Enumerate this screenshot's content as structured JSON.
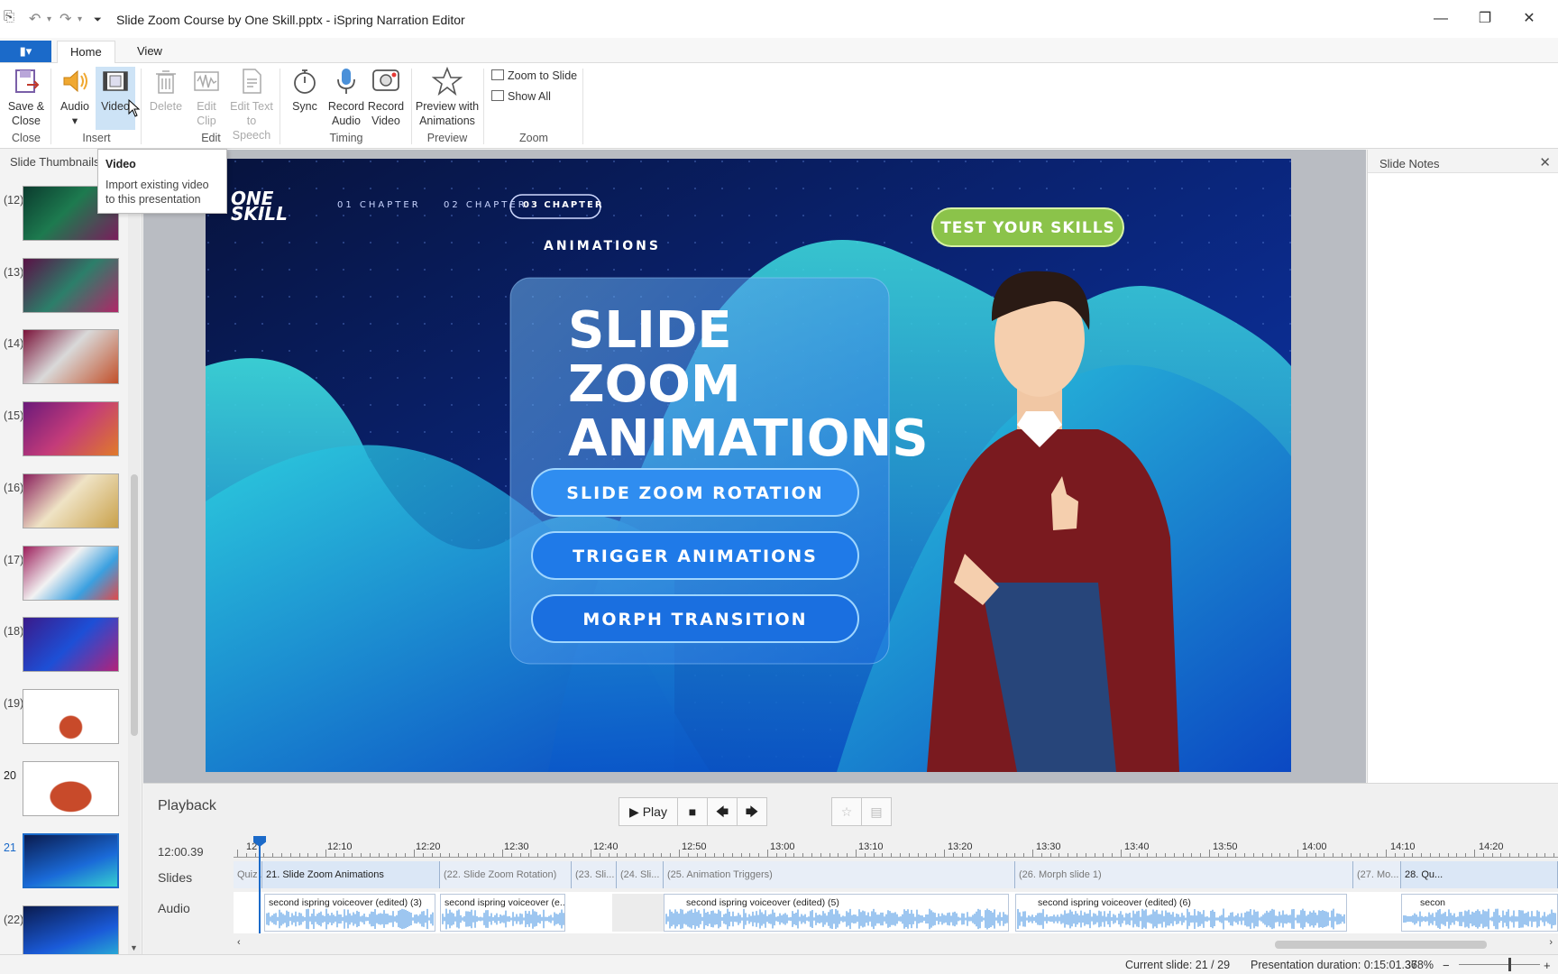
{
  "window": {
    "title": "Slide Zoom Course by One Skill.pptx - iSpring Narration Editor",
    "minimize": "—",
    "restore": "❐",
    "close": "✕"
  },
  "tabs": [
    {
      "label": "Home",
      "active": true
    },
    {
      "label": "View",
      "active": false
    }
  ],
  "ribbon": {
    "groups": {
      "close": "Close",
      "insert": "Insert",
      "edit": "Edit",
      "timing": "Timing",
      "preview": "Preview",
      "zoom": "Zoom"
    },
    "save_close": [
      "Save &",
      "Close"
    ],
    "audio": "Audio",
    "video": "Video",
    "delete": "Delete",
    "edit_clip": [
      "Edit",
      "Clip"
    ],
    "edit_text": [
      "Edit Text",
      "to Speech"
    ],
    "sync": "Sync",
    "record_audio": [
      "Record",
      "Audio"
    ],
    "record_video": [
      "Record",
      "Video"
    ],
    "preview_anim": [
      "Preview with",
      "Animations"
    ],
    "zoom_to_slide": "Zoom to Slide",
    "show_all": "Show All"
  },
  "tooltip": {
    "title": "Video",
    "description": "Import existing video to this presentation"
  },
  "thumbnails": {
    "title": "Slide Thumbnails",
    "items": [
      {
        "num": "(12)"
      },
      {
        "num": "(13)"
      },
      {
        "num": "(14)"
      },
      {
        "num": "(15)"
      },
      {
        "num": "(16)"
      },
      {
        "num": "(17)"
      },
      {
        "num": "(18)"
      },
      {
        "num": "(19)"
      },
      {
        "num": "20"
      },
      {
        "num": "21"
      },
      {
        "num": "(22)"
      }
    ]
  },
  "slide": {
    "logo_top": "ONE",
    "logo_bottom": "SKILL",
    "chapter1": "01 CHAPTER",
    "chapter2": "02 CHAPTER",
    "chapter3": "03 CHAPTER",
    "section": "ANIMATIONS",
    "cta": "TEST YOUR SKILLS",
    "headline1": "SLIDE",
    "headline2": "ZOOM",
    "headline3": "ANIMATIONS",
    "pill1": "SLIDE ZOOM ROTATION",
    "pill2": "TRIGGER ANIMATIONS",
    "pill3": "MORPH TRANSITION"
  },
  "notes": {
    "title": "Slide Notes",
    "close": "✕"
  },
  "playback": {
    "title": "Playback",
    "play": "▶ Play",
    "time": "12:00.39",
    "rows": {
      "slides": "Slides",
      "audio": "Audio"
    },
    "ruler": [
      "12:10",
      "12:20",
      "12:30",
      "12:40",
      "12:50",
      "13:00",
      "13:10",
      "13:20",
      "13:30",
      "13:40",
      "13:50",
      "14:00",
      "14:10",
      "14:20"
    ],
    "ruler_start": "12",
    "slide_segments": [
      {
        "label": "Quiz ...",
        "type": "sub"
      },
      {
        "label": "21. Slide Zoom Animations",
        "type": "main"
      },
      {
        "label": "(22. Slide Zoom Rotation)",
        "type": "sub"
      },
      {
        "label": "(23. Sli...",
        "type": "sub"
      },
      {
        "label": "(24. Sli...",
        "type": "sub"
      },
      {
        "label": "(25. Animation Triggers)",
        "type": "sub"
      },
      {
        "label": "(26. Morph slide 1)",
        "type": "sub"
      },
      {
        "label": "(27. Mo...",
        "type": "sub"
      },
      {
        "label": "28. Qu...",
        "type": "main"
      }
    ],
    "audio_clips": [
      {
        "label": "second ispring voiceover (edited) (3)"
      },
      {
        "label": "second ispring voiceover (e..."
      },
      {
        "label": "second ispring voiceover (edited) (5)"
      },
      {
        "label": "second ispring voiceover (edited) (6)"
      },
      {
        "label": "secon"
      }
    ]
  },
  "status": {
    "current_slide": "Current slide: 21 / 29",
    "duration": "Presentation duration: 0:15:01.36",
    "zoom": "378%"
  },
  "colors": {
    "accent": "#1b6ac9",
    "slide_bg": "#0a1b4f",
    "cta_green": "#8bc34a"
  }
}
